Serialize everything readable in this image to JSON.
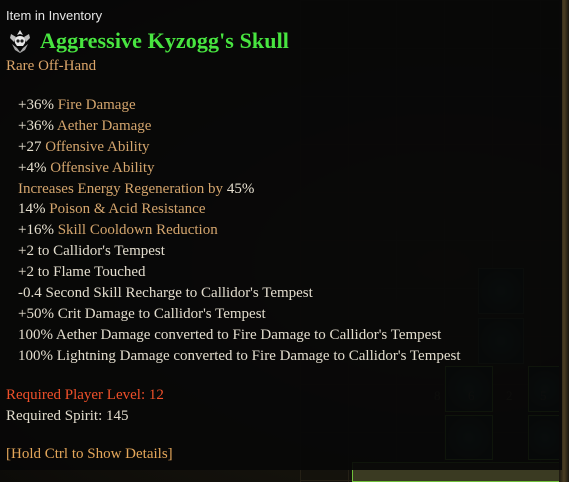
{
  "tooltip": {
    "header_label": "Item in Inventory",
    "item_name": "Aggressive Kyzogg's Skull",
    "item_type": "Rare Off-Hand",
    "item_icon": "skull-crest-icon",
    "stats": [
      {
        "value": "+36%",
        "text": " Fire Damage"
      },
      {
        "value": "+36%",
        "text": " Aether Damage"
      },
      {
        "value": "+27",
        "text": " Offensive Ability"
      },
      {
        "value": "+4%",
        "text": " Offensive Ability"
      },
      {
        "value": "",
        "text": "Increases Energy Regeneration by ",
        "suffix": "45%"
      },
      {
        "value": "14%",
        "text": " Poison & Acid Resistance"
      },
      {
        "value": "+16%",
        "text": " Skill Cooldown Reduction"
      },
      {
        "value": "",
        "text": "+2 to Callidor's Tempest"
      },
      {
        "value": "",
        "text": "+2 to Flame Touched"
      },
      {
        "value": "",
        "text": "-0.4 Second Skill Recharge to Callidor's Tempest"
      },
      {
        "value": "",
        "text": "+50% Crit Damage to Callidor's Tempest"
      },
      {
        "value": "",
        "text": "100% Aether Damage converted to Fire Damage to Callidor's Tempest"
      },
      {
        "value": "",
        "text": "100% Lightning Damage converted to Fire Damage to Callidor's Tempest"
      }
    ],
    "required_level": "Required Player Level: 12",
    "required_spirit": "Required Spirit: 145",
    "hint": "[Hold Ctrl to Show Details]"
  },
  "background": {
    "inventory_numbers": [
      "8",
      "6",
      "2",
      "5"
    ]
  },
  "colors": {
    "item_name": "#48e540",
    "item_type": "#dca66a",
    "stat_value": "#e5dfcf",
    "stat_label": "#d4a56d",
    "required_level": "#f0502a",
    "hint": "#e4a75a"
  }
}
